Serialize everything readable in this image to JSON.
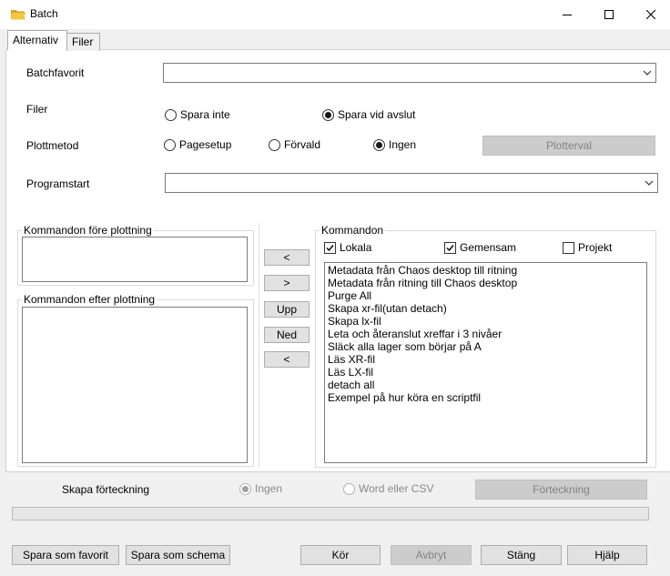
{
  "window": {
    "title": "Batch"
  },
  "tabs": [
    {
      "label": "Alternativ"
    },
    {
      "label": "Filer"
    }
  ],
  "form": {
    "batchfavorit_label": "Batchfavorit",
    "filer_label": "Filer",
    "filer_options": [
      "Spara inte",
      "Spara vid avslut"
    ],
    "filer_selected": "Spara vid avslut",
    "plottmetod_label": "Plottmetod",
    "plottmetod_options": [
      "Pagesetup",
      "Förvald",
      "Ingen"
    ],
    "plottmetod_selected": "Ingen",
    "plotterval_button": "Plotterval",
    "programstart_label": "Programstart"
  },
  "groups": {
    "fore_label": "Kommandon före plottning",
    "efter_label": "Kommandon efter plottning",
    "kommandon_label": "Kommandon"
  },
  "mid_buttons": {
    "add_left": "<",
    "remove_right": ">",
    "up": "Upp",
    "down": "Ned",
    "add_left_2": "<"
  },
  "filters": [
    {
      "label": "Lokala",
      "checked": true
    },
    {
      "label": "Gemensam",
      "checked": true
    },
    {
      "label": "Projekt",
      "checked": false
    }
  ],
  "commands": [
    "Metadata från Chaos desktop till ritning",
    "Metadata från ritning till Chaos desktop",
    "Purge All",
    "Skapa xr-fil(utan detach)",
    "Skapa lx-fil",
    "Leta och återanslut xreffar i 3 nivåer",
    "Släck alla lager som börjar på A",
    "Läs XR-fil",
    "Läs LX-fil",
    "detach all",
    "Exempel på hur köra en scriptfil"
  ],
  "forteckning": {
    "label": "Skapa förteckning",
    "options": [
      "Ingen",
      "Word eller CSV"
    ],
    "selected": "Ingen",
    "button": "Förteckning"
  },
  "progress": 0,
  "footer": {
    "save_favorite": "Spara som favorit",
    "save_schema": "Spara som schema",
    "run": "Kör",
    "abort": "Avbryt",
    "close": "Stäng",
    "help": "Hjälp"
  }
}
